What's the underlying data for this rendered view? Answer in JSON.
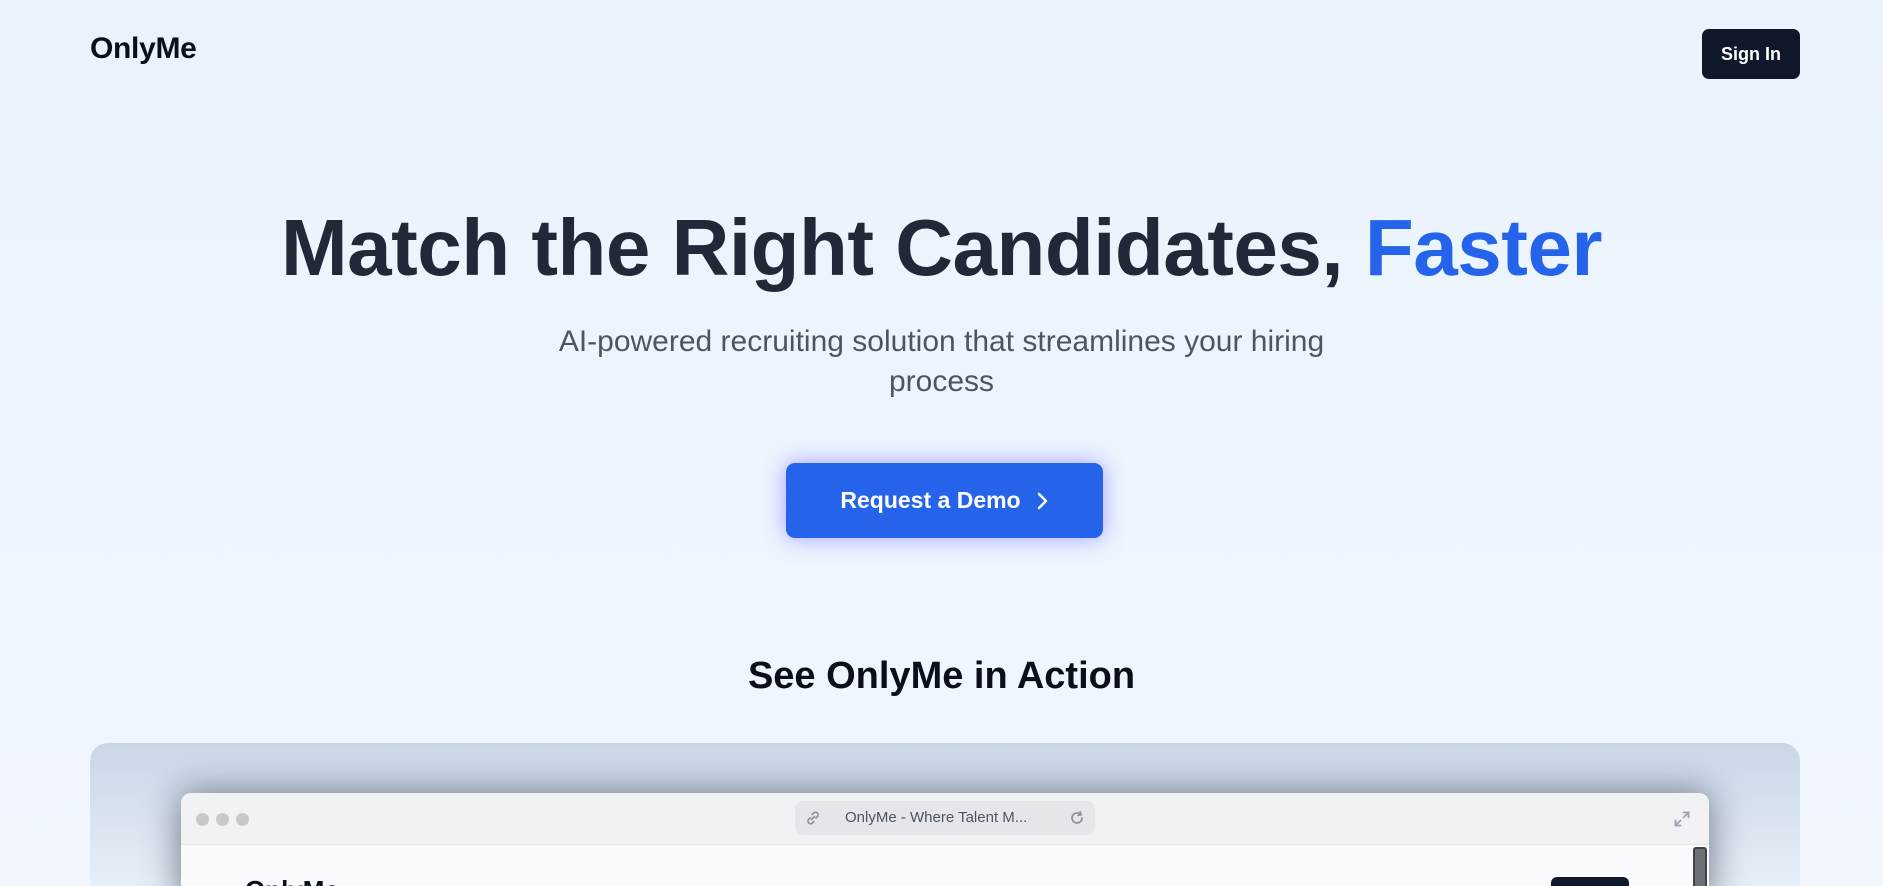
{
  "nav": {
    "logo": "OnlyMe",
    "sign_in_label": "Sign In"
  },
  "hero": {
    "title_main": "Match the Right Candidates,",
    "title_accent": "Faster",
    "subtitle": "AI-powered recruiting solution that streamlines your hiring process",
    "cta_label": "Request a Demo",
    "cta_icon": "chevron-right-icon"
  },
  "demo": {
    "section_title": "See OnlyMe in Action",
    "browser": {
      "url_text": "OnlyMe - Where Talent M...",
      "link_icon": "link-icon",
      "reload_icon": "reload-icon",
      "expand_icon": "expand-icon"
    },
    "inner_logo": "OnlyMe"
  },
  "colors": {
    "accent": "#2563eb",
    "dark": "#0f172a",
    "heading": "#1f2937",
    "subtext": "#4b5563"
  }
}
